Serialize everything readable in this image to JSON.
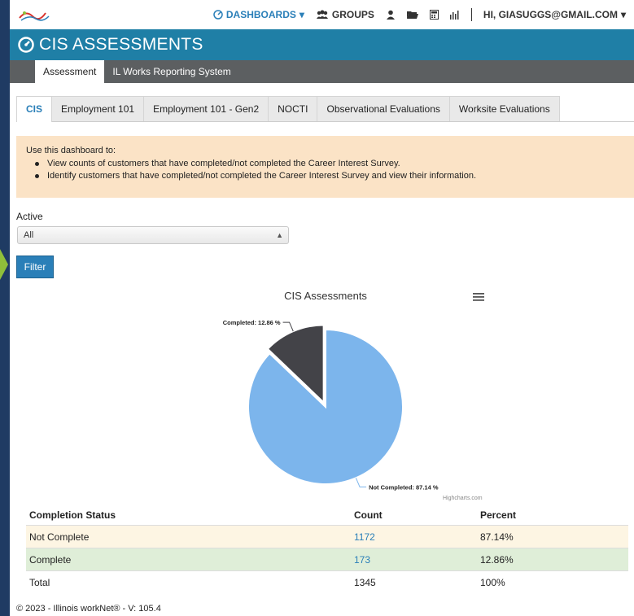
{
  "topnav": {
    "dashboards": "DASHBOARDS",
    "groups": "GROUPS",
    "greeting": "HI, GIASUGGS@GMAIL.COM"
  },
  "header": {
    "title": "CIS ASSESSMENTS"
  },
  "subnav": {
    "items": [
      {
        "label": "Assessment"
      },
      {
        "label": "IL Works Reporting System"
      }
    ]
  },
  "tabs": [
    {
      "label": "CIS"
    },
    {
      "label": "Employment 101"
    },
    {
      "label": "Employment 101 - Gen2"
    },
    {
      "label": "NOCTI"
    },
    {
      "label": "Observational Evaluations"
    },
    {
      "label": "Worksite Evaluations"
    }
  ],
  "info": {
    "intro": "Use this dashboard to:",
    "bullets": [
      "View counts of customers that have completed/not completed the Career Interest Survey.",
      "Identify customers that have completed/not completed the Career Interest Survey and view their information."
    ]
  },
  "filter": {
    "label": "Active",
    "selected": "All",
    "button": "Filter"
  },
  "chart_data": {
    "type": "pie",
    "title": "CIS Assessments",
    "slices": [
      {
        "label": "Not Completed",
        "value": 87.14,
        "color": "#7cb5ec",
        "datalabel": "Not Completed: 87.14 %"
      },
      {
        "label": "Completed",
        "value": 12.86,
        "color": "#434348",
        "datalabel": "Completed: 12.86 %"
      }
    ],
    "credits": "Highcharts.com"
  },
  "table": {
    "headers": [
      "Completion Status",
      "Count",
      "Percent"
    ],
    "rows": [
      {
        "status": "Not Complete",
        "count": "1172",
        "percent": "87.14%"
      },
      {
        "status": "Complete",
        "count": "173",
        "percent": "12.86%"
      },
      {
        "status": "Total",
        "count": "1345",
        "percent": "100%"
      }
    ]
  },
  "footer": "© 2023 - Illinois workNet® - V: 105.4"
}
